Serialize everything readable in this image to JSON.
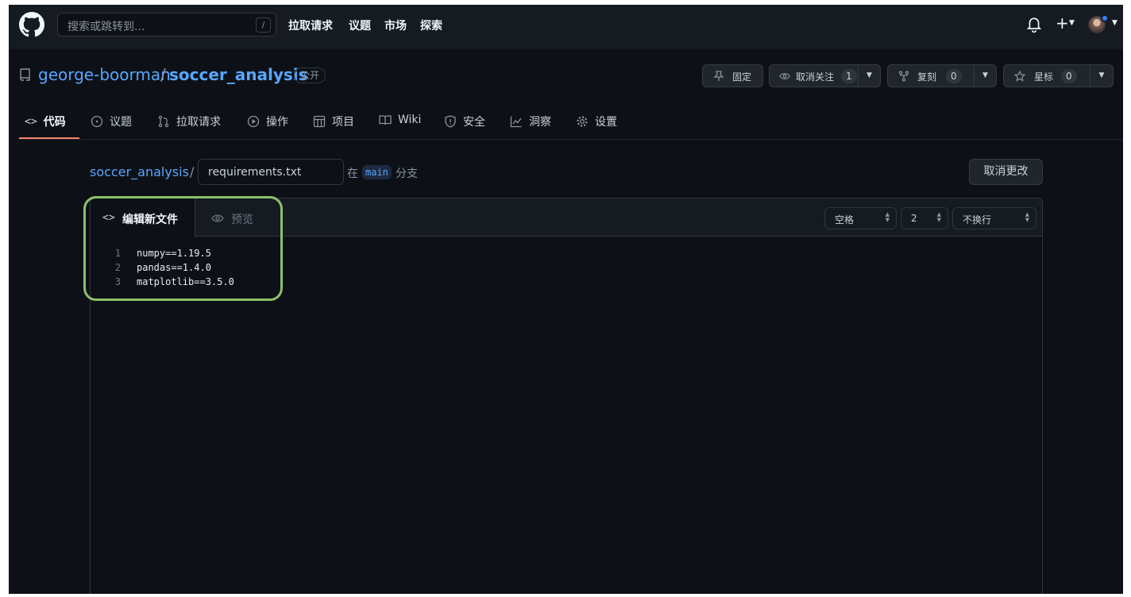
{
  "header": {
    "search_placeholder": "搜索或跳转到...",
    "search_shortcut": "/",
    "nav": [
      "拉取请求",
      "议题",
      "市场",
      "探索"
    ]
  },
  "repo": {
    "owner": "george-boorman",
    "separator": "/",
    "name": "soccer_analysis",
    "visibility": "公开",
    "actions": {
      "pin_label": "固定",
      "watch_label": "取消关注",
      "watch_count": "1",
      "fork_label": "复刻",
      "fork_count": "0",
      "star_label": "星标",
      "star_count": "0"
    },
    "tabs": [
      "代码",
      "议题",
      "拉取请求",
      "操作",
      "项目",
      "Wiki",
      "安全",
      "洞察",
      "设置"
    ],
    "active_tab": "代码"
  },
  "breadcrumb": {
    "repo": "soccer_analysis",
    "separator": "/",
    "filename": "requirements.txt",
    "in_label": "在",
    "branch": "main",
    "branch_suffix": "分支",
    "cancel_label": "取消更改"
  },
  "editor": {
    "edit_tab": "编辑新文件",
    "preview_tab": "预览",
    "indent_mode": "空格",
    "indent_size": "2",
    "wrap_mode": "不换行",
    "lines": [
      {
        "num": "1",
        "text": "numpy==1.19.5"
      },
      {
        "num": "2",
        "text": "pandas==1.4.0"
      },
      {
        "num": "3",
        "text": "matplotlib==3.5.0"
      }
    ]
  },
  "colors": {
    "background": "#0d1117",
    "header": "#161b22",
    "link": "#58a6ff",
    "active_tab_underline": "#f78166",
    "highlight_outline": "#8dc06a"
  }
}
